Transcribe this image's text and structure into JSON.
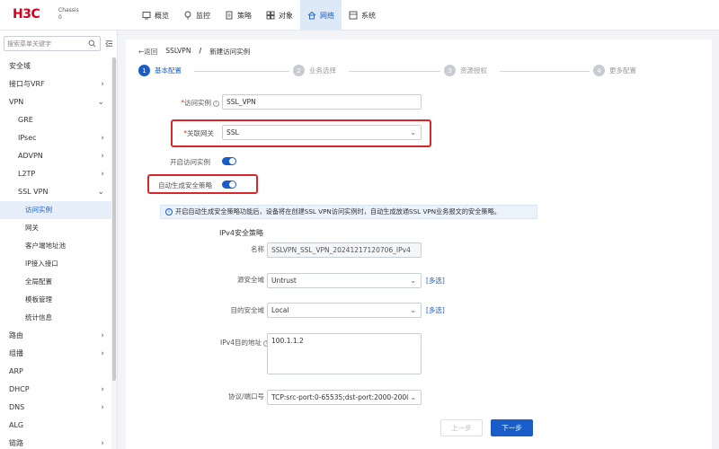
{
  "brand": {
    "logo_text": "H3C",
    "device_line1": "Chassis",
    "device_line2": "0"
  },
  "topnav": [
    {
      "label": "概览",
      "icon": "overview-icon",
      "active": false
    },
    {
      "label": "监控",
      "icon": "monitor-icon",
      "active": false
    },
    {
      "label": "策略",
      "icon": "policy-icon",
      "active": false
    },
    {
      "label": "对象",
      "icon": "object-icon",
      "active": false
    },
    {
      "label": "网络",
      "icon": "network-icon",
      "active": true
    },
    {
      "label": "系统",
      "icon": "system-icon",
      "active": false
    }
  ],
  "sidebar": {
    "search_placeholder": "搜索菜单关键字",
    "items": [
      {
        "label": "安全域",
        "level": 1,
        "chevron": ""
      },
      {
        "label": "接口与VRF",
        "level": 1,
        "chevron": "›"
      },
      {
        "label": "VPN",
        "level": 1,
        "chevron": "⌄"
      },
      {
        "label": "GRE",
        "level": 2,
        "chevron": ""
      },
      {
        "label": "IPsec",
        "level": 2,
        "chevron": "›"
      },
      {
        "label": "ADVPN",
        "level": 2,
        "chevron": "›"
      },
      {
        "label": "L2TP",
        "level": 2,
        "chevron": "›"
      },
      {
        "label": "SSL VPN",
        "level": 2,
        "chevron": "⌄"
      },
      {
        "label": "访问实例",
        "level": 3,
        "chevron": "",
        "active": true
      },
      {
        "label": "网关",
        "level": 3,
        "chevron": ""
      },
      {
        "label": "客户端地址池",
        "level": 3,
        "chevron": ""
      },
      {
        "label": "IP接入接口",
        "level": 3,
        "chevron": ""
      },
      {
        "label": "全局配置",
        "level": 3,
        "chevron": ""
      },
      {
        "label": "模板管理",
        "level": 3,
        "chevron": ""
      },
      {
        "label": "统计信息",
        "level": 3,
        "chevron": ""
      },
      {
        "label": "路由",
        "level": 1,
        "chevron": "›"
      },
      {
        "label": "组播",
        "level": 1,
        "chevron": "›"
      },
      {
        "label": "ARP",
        "level": 1,
        "chevron": ""
      },
      {
        "label": "DHCP",
        "level": 1,
        "chevron": "›"
      },
      {
        "label": "DNS",
        "level": 1,
        "chevron": "›"
      },
      {
        "label": "ALG",
        "level": 1,
        "chevron": ""
      },
      {
        "label": "链路",
        "level": 1,
        "chevron": "›"
      }
    ]
  },
  "breadcrumb": {
    "back": "←返回",
    "parent": "SSLVPN",
    "separator": "/",
    "current": "新建访问实例"
  },
  "steps": [
    {
      "num": "1",
      "label": "基本配置",
      "active": true
    },
    {
      "num": "2",
      "label": "业务选择",
      "active": false
    },
    {
      "num": "3",
      "label": "资源授权",
      "active": false
    },
    {
      "num": "4",
      "label": "更多配置",
      "active": false
    }
  ],
  "form": {
    "instance_label": "访问实例",
    "instance_value": "SSL_VPN",
    "gateway_label": "关联网关",
    "gateway_value": "SSL",
    "enable_instance_label": "开启访问实例",
    "auto_policy_label": "自动生成安全策略",
    "info_text": "开启自动生成安全策略功能后，设备将在创建SSL VPN访问实例时，自动生成放通SSL VPN业务报文的安全策略。",
    "ipv4_section_title": "IPv4安全策略",
    "name_label": "名称",
    "name_value": "SSLVPN_SSL_VPN_20241217120706_IPv4",
    "src_zone_label": "源安全域",
    "src_zone_value": "Untrust",
    "dst_zone_label": "目的安全域",
    "dst_zone_value": "Local",
    "multi_select": "[多选]",
    "ipv4_dst_label": "IPv4目的地址",
    "ipv4_dst_value": "100.1.1.2",
    "proto_label": "协议/端口号",
    "proto_value": "TCP:src-port:0-65535;dst-port:2000-2000"
  },
  "buttons": {
    "prev": "上一步",
    "next": "下一步"
  },
  "colors": {
    "accent": "#1a5cc8",
    "brand": "#d6001c",
    "highlight": "#d9262b"
  }
}
